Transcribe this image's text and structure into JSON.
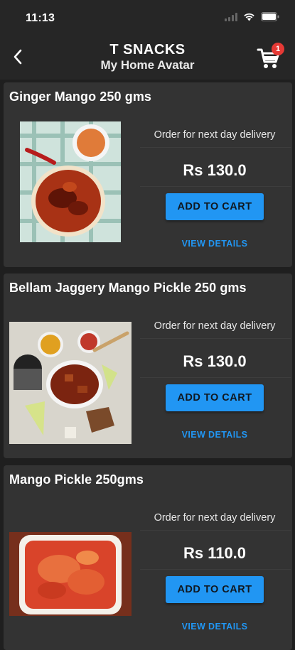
{
  "status_bar": {
    "time": "11:13"
  },
  "header": {
    "title": "T SNACKS",
    "subtitle": "My Home Avatar",
    "cart_count": "1"
  },
  "products": [
    {
      "name": "Ginger Mango 250 gms",
      "delivery": "Order for next day delivery",
      "price": "Rs 130.0",
      "add_label": "ADD TO CART",
      "details_label": "VIEW DETAILS"
    },
    {
      "name": "Bellam Jaggery Mango Pickle 250 gms",
      "delivery": "Order for next day delivery",
      "price": "Rs 130.0",
      "add_label": "ADD TO CART",
      "details_label": "VIEW DETAILS"
    },
    {
      "name": "Mango Pickle 250gms",
      "delivery": "Order for next day delivery",
      "price": "Rs 110.0",
      "add_label": "ADD TO CART",
      "details_label": "VIEW DETAILS"
    }
  ],
  "colors": {
    "background": "#1f1f1f",
    "card": "#333333",
    "accent": "#2196f3",
    "badge": "#e53935"
  }
}
